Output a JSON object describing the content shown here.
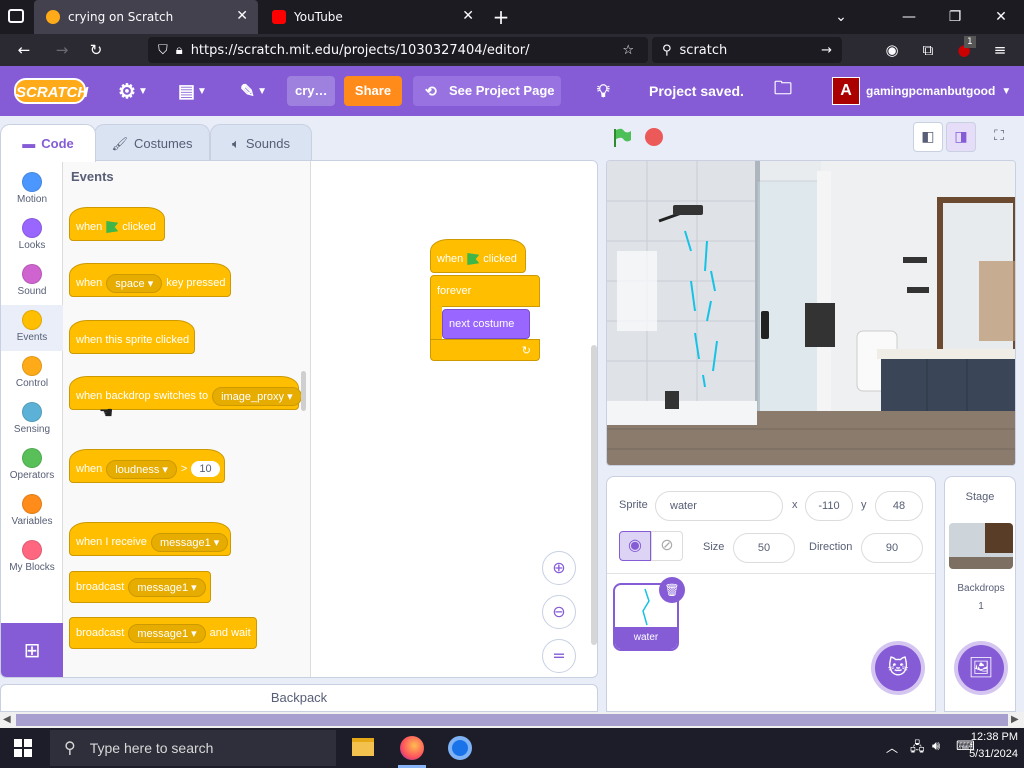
{
  "browser": {
    "tabs": [
      {
        "title": "crying on Scratch",
        "active": true
      },
      {
        "title": "YouTube",
        "active": false
      }
    ],
    "new_tab": "+",
    "url": "https://scratch.mit.edu/projects/1030327404/editor/",
    "search_value": "scratch",
    "extension_badge": "1"
  },
  "menubar": {
    "logo": "SCRATCH",
    "project_title": "cry…",
    "share_label": "Share",
    "see_project_label": "See Project Page",
    "status": "Project saved.",
    "username": "gamingpcmanbutgood",
    "avatar_letter": "A"
  },
  "tabs": {
    "code": "Code",
    "costumes": "Costumes",
    "sounds": "Sounds"
  },
  "categories": [
    {
      "label": "Motion",
      "color": "#4c97ff"
    },
    {
      "label": "Looks",
      "color": "#9966ff"
    },
    {
      "label": "Sound",
      "color": "#cf63cf"
    },
    {
      "label": "Events",
      "color": "#ffbf00"
    },
    {
      "label": "Control",
      "color": "#ffab19"
    },
    {
      "label": "Sensing",
      "color": "#5cb1d6"
    },
    {
      "label": "Operators",
      "color": "#59c059"
    },
    {
      "label": "Variables",
      "color": "#ff8c1a"
    },
    {
      "label": "My Blocks",
      "color": "#ff6680"
    }
  ],
  "palette": {
    "title": "Events",
    "blocks": {
      "b1_pre": "when",
      "b1_post": "clicked",
      "b2_pre": "when",
      "b2_key": "space",
      "b2_post": "key pressed",
      "b3": "when this sprite clicked",
      "b4_pre": "when backdrop switches to",
      "b4_dd": "image_proxy",
      "b5_pre": "when",
      "b5_dd": "loudness",
      "b5_op": ">",
      "b5_val": "10",
      "b6_pre": "when I receive",
      "b6_dd": "message1",
      "b7_pre": "broadcast",
      "b7_dd": "message1",
      "b8_pre": "broadcast",
      "b8_dd": "message1",
      "b8_post": "and wait"
    }
  },
  "script": {
    "hat_pre": "when",
    "hat_post": "clicked",
    "forever": "forever",
    "inner": "next costume"
  },
  "zoom": {
    "in": "+",
    "out": "−",
    "reset": "="
  },
  "backpack": "Backpack",
  "sprite_info": {
    "sprite_label": "Sprite",
    "sprite_name": "water",
    "x_label": "x",
    "x_value": "-110",
    "y_label": "y",
    "y_value": "48",
    "size_label": "Size",
    "size_value": "50",
    "direction_label": "Direction",
    "direction_value": "90",
    "thumb_name": "water"
  },
  "stage_pane": {
    "title": "Stage",
    "backdrops_label": "Backdrops",
    "backdrops_count": "1"
  },
  "taskbar": {
    "search_placeholder": "Type here to search",
    "time": "12:38 PM",
    "date": "5/31/2024"
  },
  "colors": {
    "scratch_purple": "#855cd6",
    "events_yellow": "#ffbf00",
    "share_orange": "#ff8c1a"
  }
}
